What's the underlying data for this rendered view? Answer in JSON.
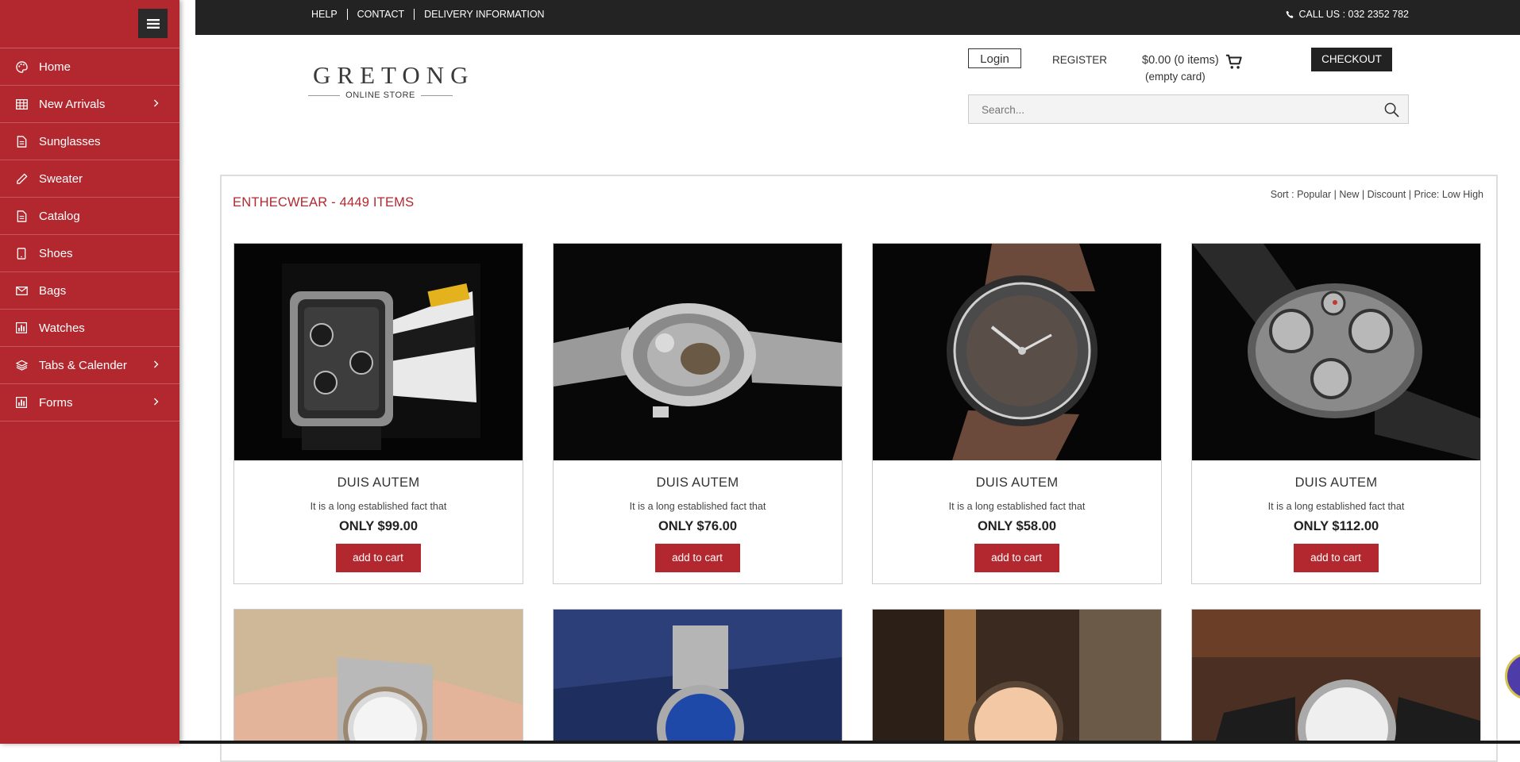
{
  "sidebar": {
    "items": [
      {
        "label": "Home",
        "icon": "palette-icon",
        "has_arrow": false
      },
      {
        "label": "New Arrivals",
        "icon": "grid-icon",
        "has_arrow": true
      },
      {
        "label": "Sunglasses",
        "icon": "document-icon",
        "has_arrow": false
      },
      {
        "label": "Sweater",
        "icon": "pencil-icon",
        "has_arrow": false
      },
      {
        "label": "Catalog",
        "icon": "document-icon",
        "has_arrow": false
      },
      {
        "label": "Shoes",
        "icon": "tablet-icon",
        "has_arrow": false
      },
      {
        "label": "Bags",
        "icon": "envelope-icon",
        "has_arrow": false
      },
      {
        "label": "Watches",
        "icon": "bar-chart-icon",
        "has_arrow": false
      },
      {
        "label": "Tabs & Calender",
        "icon": "layers-icon",
        "has_arrow": true
      },
      {
        "label": "Forms",
        "icon": "bar-chart-icon",
        "has_arrow": true
      }
    ]
  },
  "topbar": {
    "links": [
      "HELP",
      "CONTACT",
      "DELIVERY INFORMATION"
    ],
    "phone": "CALL US : 032 2352 782"
  },
  "header": {
    "logo_title": "GRETONG",
    "logo_subtitle": "ONLINE STORE",
    "login_label": "Login",
    "register_label": "REGISTER",
    "cart_amount": "$0.00 (0 items)",
    "cart_status": "(empty card)",
    "checkout_label": "CHECKOUT",
    "search_placeholder": "Search..."
  },
  "catalog": {
    "title": "ENTHECWEAR - 4449 ITEMS",
    "sort_label": "Sort :",
    "sort_options": [
      "Popular",
      "New",
      "Discount",
      "Price: Low High"
    ]
  },
  "products": [
    {
      "title": "DUIS AUTEM",
      "description": "It is a long established fact that",
      "price": "ONLY $99.00",
      "button": "add to cart"
    },
    {
      "title": "DUIS AUTEM",
      "description": "It is a long established fact that",
      "price": "ONLY $76.00",
      "button": "add to cart"
    },
    {
      "title": "DUIS AUTEM",
      "description": "It is a long established fact that",
      "price": "ONLY $58.00",
      "button": "add to cart"
    },
    {
      "title": "DUIS AUTEM",
      "description": "It is a long established fact that",
      "price": "ONLY $112.00",
      "button": "add to cart"
    }
  ],
  "colors": {
    "accent": "#b3282f",
    "topbar": "#232323",
    "checkout": "#222222"
  }
}
